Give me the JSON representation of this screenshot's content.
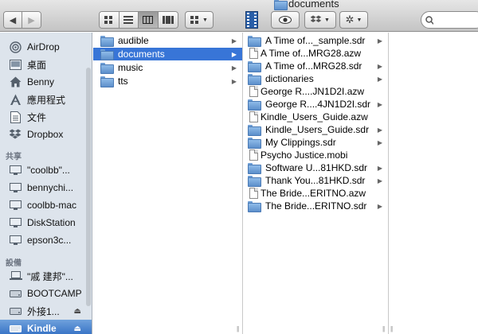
{
  "window": {
    "title": "documents"
  },
  "toolbar": {
    "back_icon": "chevron-left-icon",
    "forward_icon": "chevron-right-icon",
    "view_icons": [
      "icon-view-icon",
      "list-view-icon",
      "column-view-icon",
      "coverflow-view-icon"
    ],
    "arrange_icon": "arrange-grid-icon",
    "quicklook_icon": "eye-icon",
    "dropbox_icon": "dropbox-icon",
    "action_icon": "gear-icon",
    "search_placeholder": ""
  },
  "sidebar": {
    "favorites": [
      {
        "label": "AirDrop",
        "icon": "airdrop-icon"
      },
      {
        "label": "桌面",
        "icon": "desktop-icon"
      },
      {
        "label": "Benny",
        "icon": "home-icon"
      },
      {
        "label": "應用程式",
        "icon": "applications-icon"
      },
      {
        "label": "文件",
        "icon": "documents-icon"
      },
      {
        "label": "Dropbox",
        "icon": "dropbox-icon"
      }
    ],
    "shared_header": "共享",
    "shared": [
      {
        "label": "\"coolbb\"...",
        "icon": "computer-icon"
      },
      {
        "label": "bennychi...",
        "icon": "computer-icon"
      },
      {
        "label": "coolbb-mac",
        "icon": "computer-icon"
      },
      {
        "label": "DiskStation",
        "icon": "server-icon"
      },
      {
        "label": "epson3c...",
        "icon": "computer-icon"
      }
    ],
    "devices_header": "設備",
    "devices": [
      {
        "label": "\"戚 建邦\"...",
        "icon": "laptop-icon"
      },
      {
        "label": "BOOTCAMP",
        "icon": "disk-icon"
      },
      {
        "label": "外接1...",
        "icon": "disk-icon",
        "eject": "⏏"
      },
      {
        "label": "Kindle",
        "icon": "disk-icon",
        "eject": "⏏",
        "selected": true
      }
    ]
  },
  "column1": [
    {
      "label": "audible",
      "type": "folder"
    },
    {
      "label": "documents",
      "type": "folder",
      "selected": true
    },
    {
      "label": "music",
      "type": "folder"
    },
    {
      "label": "tts",
      "type": "folder"
    }
  ],
  "column2": [
    {
      "label": "A Time of..._sample.sdr",
      "type": "folder"
    },
    {
      "label": "A Time of...MRG28.azw",
      "type": "file"
    },
    {
      "label": "A Time of...MRG28.sdr",
      "type": "folder"
    },
    {
      "label": "dictionaries",
      "type": "folder"
    },
    {
      "label": "George R....JN1D2I.azw",
      "type": "file"
    },
    {
      "label": "George R....4JN1D2I.sdr",
      "type": "folder"
    },
    {
      "label": "Kindle_Users_Guide.azw",
      "type": "file"
    },
    {
      "label": "Kindle_Users_Guide.sdr",
      "type": "folder"
    },
    {
      "label": "My Clippings.sdr",
      "type": "folder"
    },
    {
      "label": "Psycho Justice.mobi",
      "type": "file"
    },
    {
      "label": "Software U...81HKD.sdr",
      "type": "folder"
    },
    {
      "label": "Thank You...81HKD.sdr",
      "type": "folder"
    },
    {
      "label": "The Bride...ERITNO.azw",
      "type": "file"
    },
    {
      "label": "The Bride...ERITNO.sdr",
      "type": "folder"
    }
  ]
}
